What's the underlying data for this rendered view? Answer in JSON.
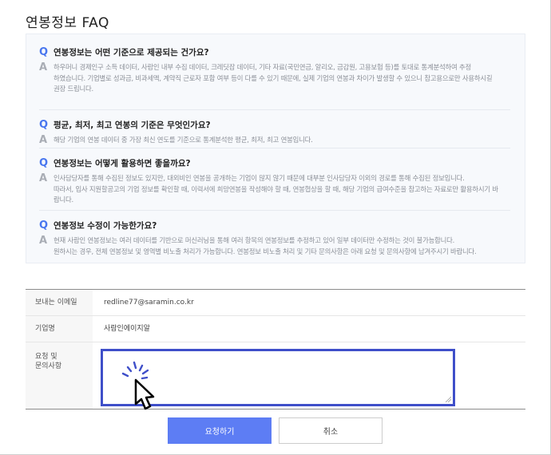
{
  "faq": {
    "title": "연봉정보 FAQ",
    "q_mark": "Q",
    "a_mark": "A",
    "items": [
      {
        "question": "연봉정보는 어떤 기준으로 제공되는 건가요?",
        "answer_lines": [
          "하우머니 경제인구 소득 데이터, 사람인 내부 수집 데이터, 크레딧잡 데이터, 기타 자료(국민연금, 알리오, 금감원, 고용보험 등)를 토대로 통계분석하여 추정",
          "하였습니다. 기업별로 성과금, 비과세액, 계약직 근로자 포함 여부 등이 다를 수 있기 때문에, 실제 기업의 연봉과 차이가 발생할 수 있으니 참고용으로만 사용하시길",
          "권장 드립니다."
        ]
      },
      {
        "question": "평균, 최저, 최고 연봉의 기준은 무엇인가요?",
        "answer_lines": [
          "해당 기업의 연봉 데이터 중 가장 최신 연도를 기준으로 통계분석한 평균, 최저, 최고 연봉입니다."
        ]
      },
      {
        "question": "연봉정보는 어떻게 활용하면 좋을까요?",
        "answer_lines": [
          "인사담당자를 통해 수집된 정보도 있지만, 대외비인 연봉을 공개하는 기업이 많지 않기 때문에 대부분 인사담당자 이외의 경로를 통해 수집된 정보입니다.",
          "따라서, 입사 지원할공고의 기업 정보를 확인할 때, 이력서에 희망연봉을 작성해야 할 때, 연봉협상을 할 때, 해당 기업의 급여수준을 참고하는 자료로만 활용하시기 바",
          "랍니다."
        ]
      },
      {
        "question": "연봉정보 수정이 가능한가요?",
        "answer_lines": [
          "현재 사람인 연봉정보는 여러 데이터를 기반으로 머신러닝을 통해 여러 항목의 연봉정보를 추정하고 있어 일부 데이터만 수정하는 것이 불가능합니다.",
          "원하시는 경우, 전체 연봉정보 및 영역별 비노출 처리가 가능합니다. 연봉정보 비노출 처리 및 기타 문의사항은 아래 요청 및 문의사항에 남겨주시기 바랍니다."
        ]
      }
    ]
  },
  "form": {
    "sender_label": "보내는 이메일",
    "sender_value": "redline77@saramin.co.kr",
    "company_label": "기업명",
    "company_value": "사람인에이지알",
    "request_label_line1": "요청 및",
    "request_label_line2": "문의사항",
    "request_value": ""
  },
  "buttons": {
    "submit": "요청하기",
    "cancel": "취소"
  },
  "colors": {
    "accent": "#4876ef",
    "button": "#5d7df4",
    "focus_border": "#3f4fc9"
  }
}
